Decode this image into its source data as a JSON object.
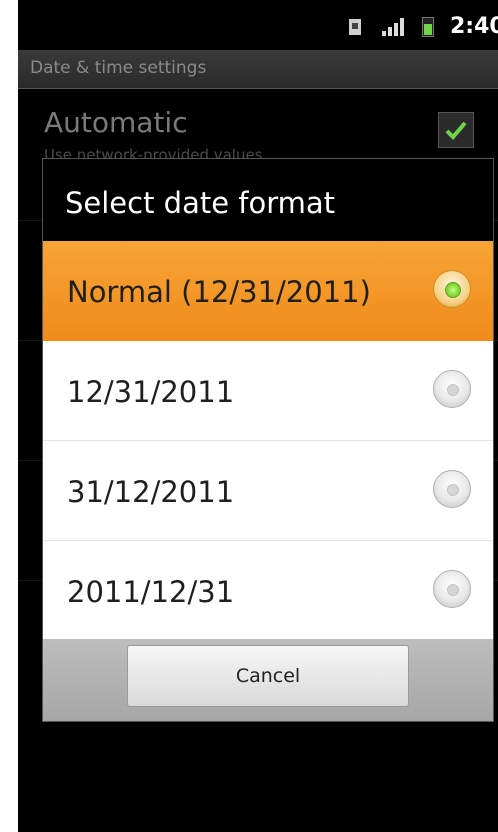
{
  "status_bar": {
    "time": "2:40",
    "icons": [
      "sim-icon",
      "signal-icon",
      "battery-icon"
    ]
  },
  "screen_title": "Date & time settings",
  "background_item": {
    "title": "Automatic",
    "subtitle": "Use network-provided values"
  },
  "dialog": {
    "title": "Select date format",
    "options": [
      {
        "label": "Normal (12/31/2011)",
        "selected": true
      },
      {
        "label": "12/31/2011",
        "selected": false
      },
      {
        "label": "31/12/2011",
        "selected": false
      },
      {
        "label": "2011/12/31",
        "selected": false
      }
    ],
    "cancel_label": "Cancel"
  },
  "colors": {
    "accent": "#f39a29",
    "check": "#6fd44a"
  }
}
